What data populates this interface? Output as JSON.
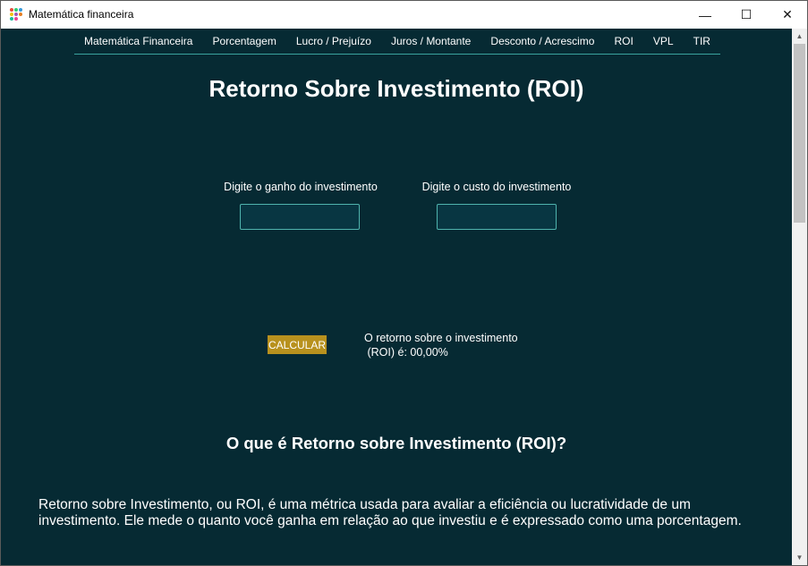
{
  "window": {
    "title": "Matemática financeira",
    "controls": {
      "minimize": "—",
      "maximize": "☐",
      "close": "✕"
    },
    "icon": "app-grid-icon"
  },
  "nav": {
    "items": [
      "Matemática Financeira",
      "Porcentagem",
      "Lucro / Prejuízo",
      "Juros / Montante",
      "Desconto / Acrescimo",
      "ROI",
      "VPL",
      "TIR"
    ]
  },
  "page": {
    "title": "Retorno Sobre Investimento (ROI)",
    "gain_label": "Digite o ganho do investimento",
    "gain_value": "",
    "cost_label": "Digite o custo do investimento",
    "cost_value": "",
    "calculate_label": "CALCULAR",
    "result_line1": "O retorno sobre o investimento",
    "result_line2": " (ROI) é: 00,00%",
    "section_title": "O que é Retorno sobre Investimento (ROI)?",
    "paragraph": "Retorno sobre Investimento, ou ROI, é uma métrica usada para avaliar a eficiência ou lucratividade de um investimento. Ele mede o quanto você ganha em relação ao que investiu e é expressado como uma porcentagem."
  },
  "colors": {
    "background": "#062a33",
    "accent_line": "#3aa39e",
    "button": "#b8911e",
    "text": "#ffffff"
  }
}
